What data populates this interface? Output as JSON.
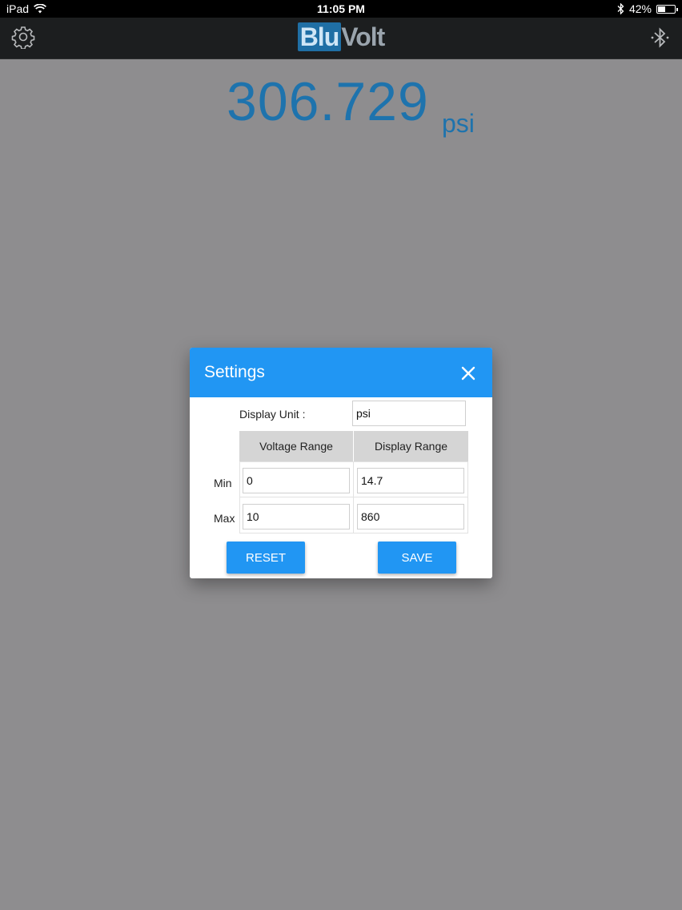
{
  "status_bar": {
    "device": "iPad",
    "time": "11:05 PM",
    "battery": "42%"
  },
  "nav": {
    "logo_part1": "Blu",
    "logo_part2": "Volt",
    "settings_icon": "gear-icon",
    "bluetooth_icon": "bluetooth-icon"
  },
  "reading": {
    "value": "306.729",
    "unit": "psi"
  },
  "dialog": {
    "title": "Settings",
    "close_icon": "close-icon",
    "display_unit_label": "Display Unit :",
    "display_unit_value": "psi",
    "columns": [
      "Voltage Range",
      "Display Range"
    ],
    "rows": [
      {
        "label": "Min",
        "voltage": "0",
        "display": "14.7"
      },
      {
        "label": "Max",
        "voltage": "10",
        "display": "860"
      }
    ],
    "reset_label": "RESET",
    "save_label": "SAVE",
    "accent_color": "#2196f3"
  }
}
